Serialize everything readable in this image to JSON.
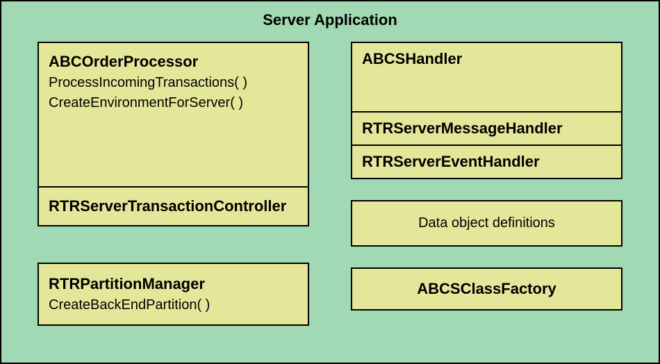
{
  "title": "Server Application",
  "left": {
    "abcorder": {
      "class_name": "ABCOrderProcessor",
      "methods": [
        "ProcessIncomingTransactions( )",
        "CreateEnvironmentForServer( )"
      ],
      "base_class": "RTRServerTransactionController"
    },
    "partition_manager": {
      "class_name": "RTRPartitionManager",
      "methods": [
        "CreateBackEndPartition( )"
      ]
    }
  },
  "right": {
    "abcshandler": {
      "class_name": "ABCSHandler",
      "base_classes": [
        "RTRServerMessageHandler",
        "RTRServerEventHandler"
      ]
    },
    "data_obj_label": "Data object definitions",
    "class_factory": "ABCSClassFactory"
  }
}
